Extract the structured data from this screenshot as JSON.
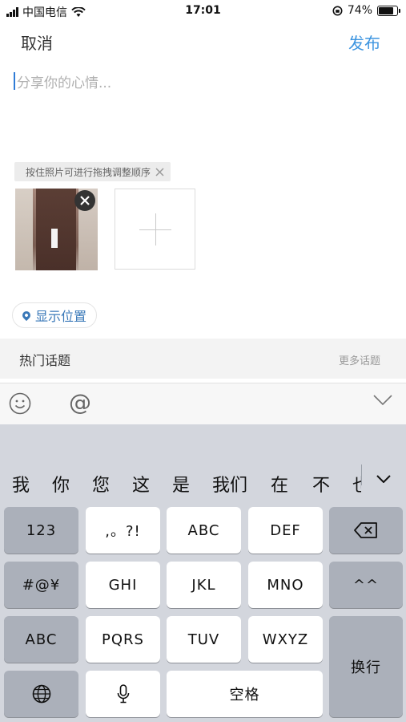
{
  "status_bar": {
    "carrier": "中国电信",
    "time": "17:01",
    "battery_percent": "74%",
    "battery_level": 0.74,
    "signal": "signal-bars-icon",
    "wifi": "wifi-icon",
    "orientation_lock": "orientation-lock-icon"
  },
  "header": {
    "cancel_label": "取消",
    "publish_label": "发布"
  },
  "editor": {
    "placeholder": "分享你的心情..."
  },
  "photos": {
    "hint": "按住照片可进行拖拽调整顺序",
    "hint_close_icon": "close-icon",
    "remove_icon": "close-icon",
    "add_icon": "plus-icon"
  },
  "location": {
    "label": "显示位置",
    "icon": "location-pin-icon"
  },
  "topics": {
    "title": "热门话题",
    "more": "更多话题"
  },
  "toolbar": {
    "emoji_icon": "emoji-icon",
    "at_label": "@",
    "collapse_icon": "chevron-down-icon"
  },
  "keyboard": {
    "candidates": [
      "我",
      "你",
      "您",
      "这",
      "是",
      "我们",
      "在",
      "不",
      "也"
    ],
    "rows": {
      "r1": [
        "123",
        ",。?!",
        "ABC",
        "DEF"
      ],
      "r2": [
        "#@¥",
        "GHI",
        "JKL",
        "MNO",
        "^^"
      ],
      "r3": [
        "ABC",
        "PQRS",
        "TUV",
        "WXYZ"
      ],
      "return_label": "换行",
      "space_label": "空格",
      "delete_icon": "backspace-icon",
      "globe_icon": "globe-icon",
      "mic_icon": "microphone-icon"
    }
  }
}
